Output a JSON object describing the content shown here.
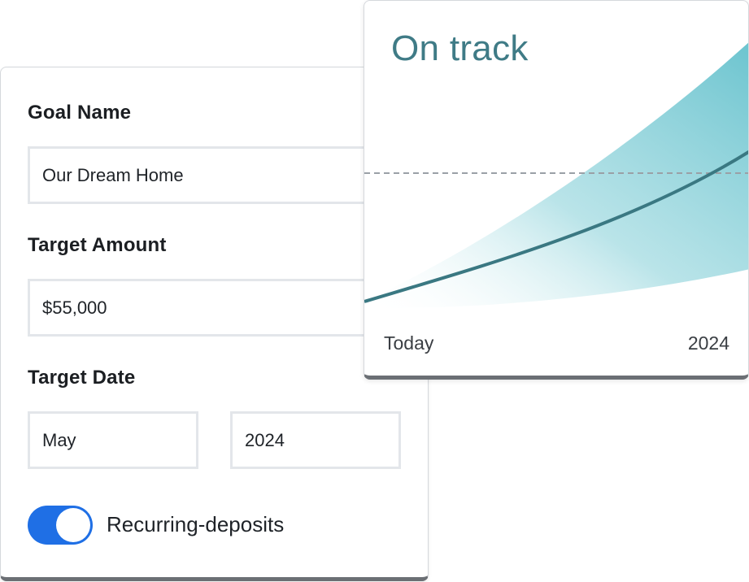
{
  "form": {
    "goal_name_label": "Goal Name",
    "goal_name_value": "Our Dream Home",
    "target_amount_label": "Target Amount",
    "target_amount_value": "$55,000",
    "target_date_label": "Target Date",
    "target_month_value": "May",
    "target_year_value": "2024",
    "recurring_label": "Recurring-deposits",
    "recurring_enabled": true
  },
  "projection": {
    "status": "On track",
    "x_start_label": "Today",
    "x_end_label": "2024"
  },
  "colors": {
    "accent": "#1f6fe5",
    "status_text": "#3f7b86",
    "projection_line": "#3a7882",
    "band_fill": "#6cc4cf",
    "target_line": "#9aa0a6"
  }
}
